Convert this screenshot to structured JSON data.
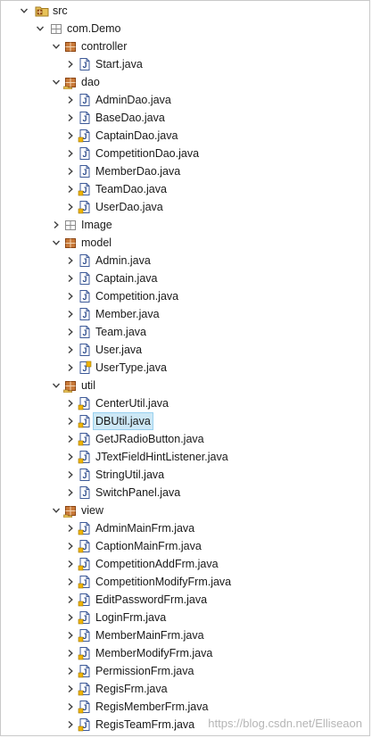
{
  "tree": {
    "src": {
      "label": "src",
      "expanded": true
    },
    "package_root": {
      "label": "com.Demo",
      "expanded": true
    },
    "controller": {
      "label": "controller",
      "expanded": true,
      "files": [
        "Start.java"
      ]
    },
    "dao": {
      "label": "dao",
      "expanded": true,
      "files": [
        "AdminDao.java",
        "BaseDao.java",
        "CaptainDao.java",
        "CompetitionDao.java",
        "MemberDao.java",
        "TeamDao.java",
        "UserDao.java"
      ]
    },
    "image": {
      "label": "Image",
      "expanded": false
    },
    "model": {
      "label": "model",
      "expanded": true,
      "files": [
        "Admin.java",
        "Captain.java",
        "Competition.java",
        "Member.java",
        "Team.java",
        "User.java",
        "UserType.java"
      ]
    },
    "util": {
      "label": "util",
      "expanded": true,
      "files": [
        "CenterUtil.java",
        "DBUtil.java",
        "GetJRadioButton.java",
        "JTextFieldHintListener.java",
        "StringUtil.java",
        "SwitchPanel.java"
      ],
      "selected": "DBUtil.java"
    },
    "view": {
      "label": "view",
      "expanded": true,
      "files": [
        "AdminMainFrm.java",
        "CaptionMainFrm.java",
        "CompetitionAddFrm.java",
        "CompetitionModifyFrm.java",
        "EditPasswordFrm.java",
        "LoginFrm.java",
        "MemberMainFrm.java",
        "MemberModifyFrm.java",
        "PermissionFrm.java",
        "RegisFrm.java",
        "RegisMemberFrm.java",
        "RegisTeamFrm.java"
      ]
    }
  },
  "watermark": "https://blog.csdn.net/Elliseaon",
  "colors": {
    "selection_bg": "#cde8f6",
    "package_icon": "#b5651d",
    "java_icon_border": "#3d5a98"
  }
}
